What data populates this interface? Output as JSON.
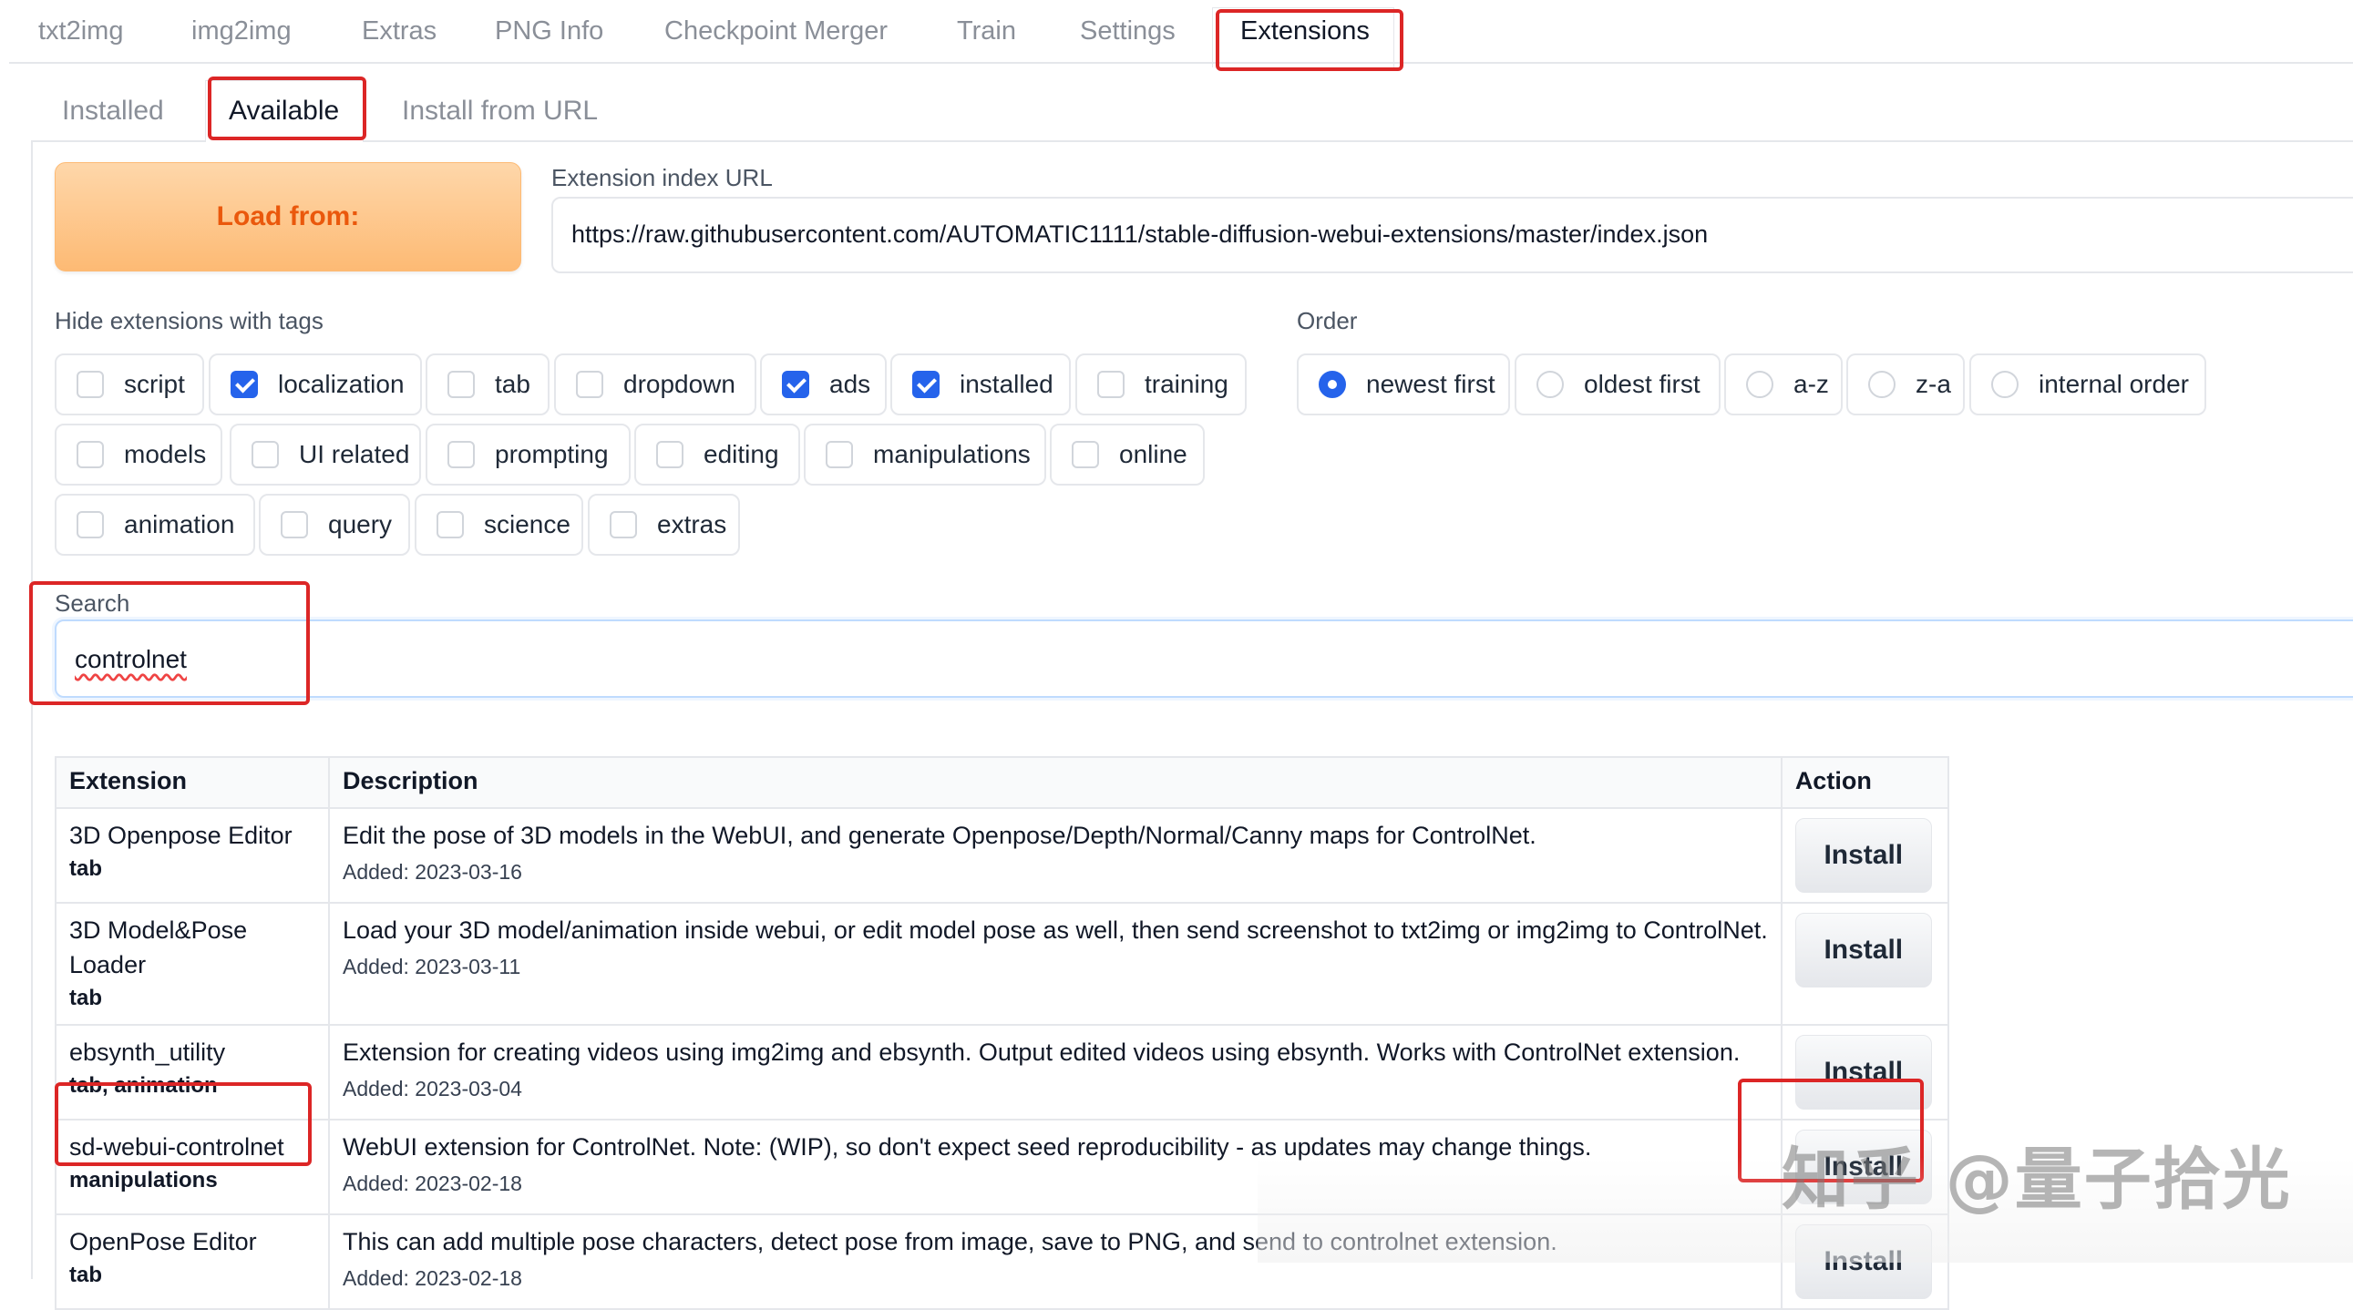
{
  "top_tabs": [
    "txt2img",
    "img2img",
    "Extras",
    "PNG Info",
    "Checkpoint Merger",
    "Train",
    "Settings",
    "Extensions"
  ],
  "sub_tabs": [
    "Installed",
    "Available",
    "Install from URL"
  ],
  "load": {
    "button_label": "Load from:",
    "url_label": "Extension index URL",
    "url_value": "https://raw.githubusercontent.com/AUTOMATIC1111/stable-diffusion-webui-extensions/master/index.json"
  },
  "hide_tags": {
    "label": "Hide extensions with tags",
    "items": [
      {
        "label": "script",
        "checked": false
      },
      {
        "label": "localization",
        "checked": true
      },
      {
        "label": "tab",
        "checked": false
      },
      {
        "label": "dropdown",
        "checked": false
      },
      {
        "label": "ads",
        "checked": true
      },
      {
        "label": "installed",
        "checked": true
      },
      {
        "label": "training",
        "checked": false
      },
      {
        "label": "models",
        "checked": false
      },
      {
        "label": "UI related",
        "checked": false
      },
      {
        "label": "prompting",
        "checked": false
      },
      {
        "label": "editing",
        "checked": false
      },
      {
        "label": "manipulations",
        "checked": false
      },
      {
        "label": "online",
        "checked": false
      },
      {
        "label": "animation",
        "checked": false
      },
      {
        "label": "query",
        "checked": false
      },
      {
        "label": "science",
        "checked": false
      },
      {
        "label": "extras",
        "checked": false
      }
    ]
  },
  "order": {
    "label": "Order",
    "options": [
      {
        "label": "newest first",
        "selected": true
      },
      {
        "label": "oldest first",
        "selected": false
      },
      {
        "label": "a-z",
        "selected": false
      },
      {
        "label": "z-a",
        "selected": false
      },
      {
        "label": "internal order",
        "selected": false
      }
    ]
  },
  "search": {
    "label": "Search",
    "value": "controlnet"
  },
  "table": {
    "headers": [
      "Extension",
      "Description",
      "Action"
    ],
    "rows": [
      {
        "name": "3D Openpose Editor",
        "tags": "tab",
        "description": "Edit the pose of 3D models in the WebUI, and generate Openpose/Depth/Normal/Canny maps for ControlNet.",
        "added": "Added: 2023-03-16",
        "action": "Install"
      },
      {
        "name": "3D Model&Pose Loader",
        "tags": "tab",
        "description": "Load your 3D model/animation inside webui, or edit model pose as well, then send screenshot to txt2img or img2img to ControlNet.",
        "added": "Added: 2023-03-11",
        "action": "Install"
      },
      {
        "name": "ebsynth_utility",
        "tags": "tab, animation",
        "description": "Extension for creating videos using img2img and ebsynth. Output edited videos using ebsynth. Works with ControlNet extension.",
        "added": "Added: 2023-03-04",
        "action": "Install"
      },
      {
        "name": "sd-webui-controlnet",
        "tags": "manipulations",
        "description": "WebUI extension for ControlNet. Note: (WIP), so don't expect seed reproducibility - as updates may change things.",
        "added": "Added: 2023-02-18",
        "action": "Install"
      },
      {
        "name": "OpenPose Editor",
        "tags": "tab",
        "description": "This can add multiple pose characters, detect pose from image, save to PNG, and send to controlnet extension.",
        "added": "Added: 2023-02-18",
        "action": "Install"
      }
    ]
  },
  "watermark": "知乎 @量子拾光",
  "colors": {
    "accent": "#2563eb",
    "highlight": "#dc2626",
    "load_button": "#fdba74"
  }
}
